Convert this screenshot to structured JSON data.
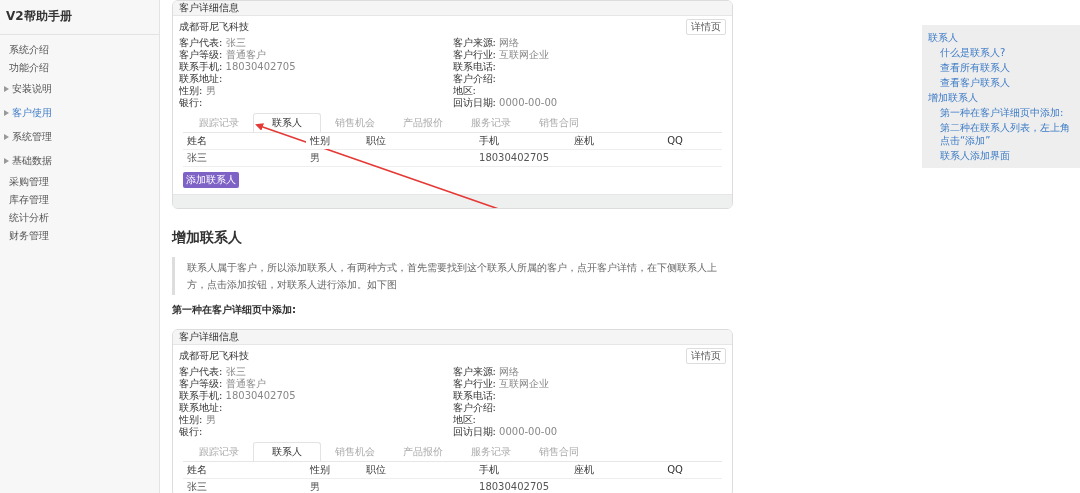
{
  "sidebar": {
    "title": "V2帮助手册",
    "items": [
      {
        "label": "系统介绍",
        "expandable": false,
        "selected": false
      },
      {
        "label": "功能介绍",
        "expandable": false,
        "selected": false
      },
      {
        "label": "安装说明",
        "expandable": true,
        "selected": false
      },
      {
        "label": "客户使用",
        "expandable": true,
        "selected": true
      },
      {
        "label": "系统管理",
        "expandable": true,
        "selected": false
      },
      {
        "label": "基础数据",
        "expandable": true,
        "selected": false
      },
      {
        "label": "采购管理",
        "expandable": false,
        "selected": false
      },
      {
        "label": "库存管理",
        "expandable": false,
        "selected": false
      },
      {
        "label": "统计分析",
        "expandable": false,
        "selected": false
      },
      {
        "label": "财务管理",
        "expandable": false,
        "selected": false
      }
    ]
  },
  "blocks": [
    {
      "kind": "screenshot",
      "header": "客户详细信息",
      "company": "成都哥尼飞科技",
      "edit_button": "详情页",
      "annotation_arrow": true,
      "left_fields": [
        {
          "label": "客户代表:",
          "value": "张三"
        },
        {
          "label": "客户等级:",
          "value": "普通客户"
        },
        {
          "label": "联系手机:",
          "value": "18030402705"
        },
        {
          "label": "联系地址:"
        },
        {
          "label": "性别:",
          "value": "男"
        },
        {
          "label": "银行:"
        }
      ],
      "right_fields": [
        {
          "label": "客户来源:",
          "value": "网络"
        },
        {
          "label": "客户行业:",
          "value": "互联网企业"
        },
        {
          "label": "联系电话:"
        },
        {
          "label": "客户介绍:"
        },
        {
          "label": "地区:"
        },
        {
          "label": "回访日期:",
          "value": "0000-00-00"
        }
      ],
      "tabs": [
        {
          "label": "跟踪记录",
          "selected": false
        },
        {
          "label": "联系人",
          "selected": true
        },
        {
          "label": "销售机会",
          "selected": false
        },
        {
          "label": "产品报价",
          "selected": false
        },
        {
          "label": "服务记录",
          "selected": false
        },
        {
          "label": "销售合同",
          "selected": false
        }
      ],
      "columns": [
        "姓名",
        "性别",
        "职位",
        "手机",
        "座机",
        "QQ"
      ],
      "rows": [
        [
          "张三",
          "男",
          "",
          "18030402705",
          "",
          ""
        ]
      ],
      "add_button": "添加联系人"
    },
    {
      "kind": "heading",
      "text": "增加联系人"
    },
    {
      "kind": "quote",
      "text": "联系人属于客户，所以添加联系人，有两种方式，首先需要找到这个联系人所属的客户，点开客户详情，在下侧联系人上方，点击添加按钮，对联系人进行添加。如下图"
    },
    {
      "kind": "bold_paragraph",
      "text": "第一种在客户详细页中添加:"
    },
    {
      "kind": "screenshot",
      "header": "客户详细信息",
      "company": "成都哥尼飞科技",
      "edit_button": "详情页",
      "annotation_arrow": false,
      "left_fields": [
        {
          "label": "客户代表:",
          "value": "张三"
        },
        {
          "label": "客户等级:",
          "value": "普通客户"
        },
        {
          "label": "联系手机:",
          "value": "18030402705"
        },
        {
          "label": "联系地址:"
        },
        {
          "label": "性别:",
          "value": "男"
        },
        {
          "label": "银行:"
        }
      ],
      "right_fields": [
        {
          "label": "客户来源:",
          "value": "网络"
        },
        {
          "label": "客户行业:",
          "value": "互联网企业"
        },
        {
          "label": "联系电话:"
        },
        {
          "label": "客户介绍:"
        },
        {
          "label": "地区:"
        },
        {
          "label": "回访日期:",
          "value": "0000-00-00"
        }
      ],
      "tabs": [
        {
          "label": "跟踪记录",
          "selected": false
        },
        {
          "label": "联系人",
          "selected": true
        },
        {
          "label": "销售机会",
          "selected": false
        },
        {
          "label": "产品报价",
          "selected": false
        },
        {
          "label": "服务记录",
          "selected": false
        },
        {
          "label": "销售合同",
          "selected": false
        }
      ],
      "columns": [
        "姓名",
        "性别",
        "职位",
        "手机",
        "座机",
        "QQ"
      ],
      "rows": [
        [
          "张三",
          "男",
          "",
          "18030402705",
          "",
          ""
        ]
      ]
    }
  ],
  "toc": [
    {
      "label": "联系人",
      "children": [
        {
          "label": "什么是联系人?"
        },
        {
          "label": "查看所有联系人"
        },
        {
          "label": "查看客户联系人"
        }
      ]
    },
    {
      "label": "增加联系人",
      "children": [
        {
          "label": "第一种在客户详细页中添加:"
        },
        {
          "label": "第二种在联系人列表，左上角点击“添加”"
        },
        {
          "label": "联系人添加界面"
        }
      ]
    }
  ]
}
